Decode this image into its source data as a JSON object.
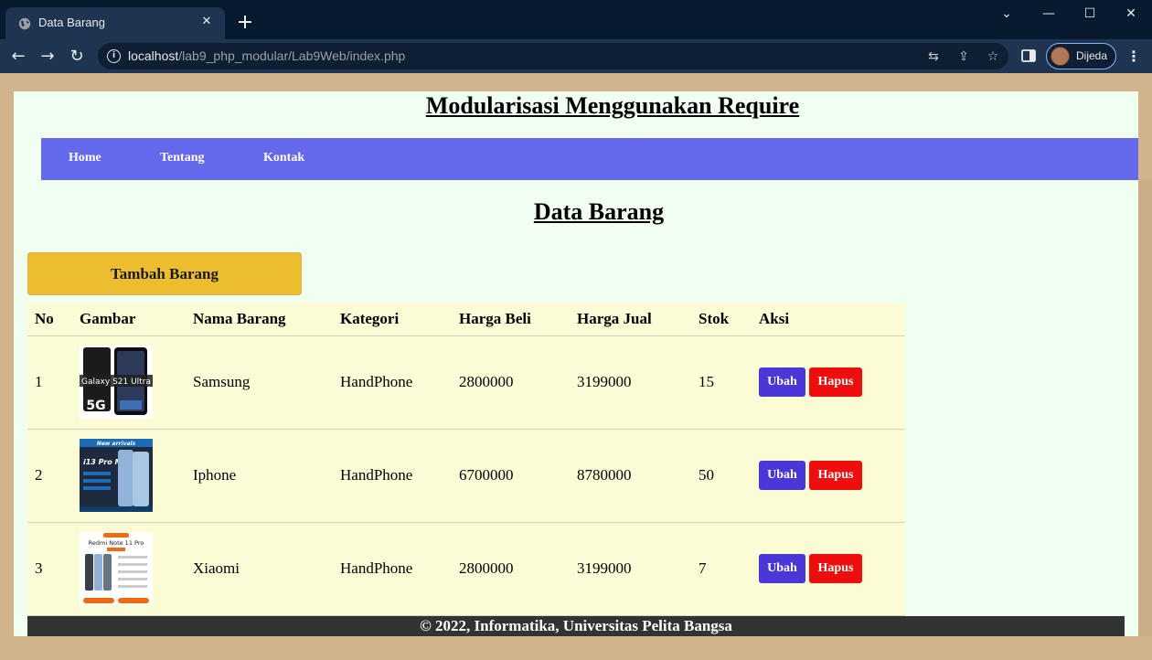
{
  "browser": {
    "tab_title": "Data Barang",
    "tab_close": "✕",
    "new_tab": "+",
    "url_host": "localhost",
    "url_path": "/lab9_php_modular/Lab9Web/index.php",
    "profile_name": "Dijeda",
    "window_controls": {
      "tab_search": "⌄",
      "minimize": "—",
      "maximize": "☐",
      "close": "✕"
    },
    "nav": {
      "back": "←",
      "forward": "→",
      "reload": "↻"
    },
    "omnibox_icons": {
      "translate": "⇆",
      "share": "⇪",
      "bookmark": "☆"
    },
    "menu": "⋮"
  },
  "page": {
    "title": "Modularisasi Menggunakan Require",
    "nav": [
      {
        "label": "Home"
      },
      {
        "label": "Tentang"
      },
      {
        "label": "Kontak"
      }
    ],
    "section_title": "Data Barang",
    "add_button": "Tambah Barang",
    "table": {
      "headers": [
        "No",
        "Gambar",
        "Nama Barang",
        "Kategori",
        "Harga Beli",
        "Harga Jual",
        "Stok",
        "Aksi"
      ],
      "rows": [
        {
          "no": "1",
          "nama": "Samsung",
          "kategori": "HandPhone",
          "harga_beli": "2800000",
          "harga_jual": "3199000",
          "stok": "15",
          "image_caption": "Galaxy S21 Ultra",
          "image_badge": "5G"
        },
        {
          "no": "2",
          "nama": "Iphone",
          "kategori": "HandPhone",
          "harga_beli": "6700000",
          "harga_jual": "8780000",
          "stok": "50",
          "image_caption": "New arrivals",
          "image_badge": "i13 Pro Max"
        },
        {
          "no": "3",
          "nama": "Xiaomi",
          "kategori": "HandPhone",
          "harga_beli": "2800000",
          "harga_jual": "3199000",
          "stok": "7",
          "image_caption": "Redmi Note 11 Pro",
          "image_badge": ""
        }
      ],
      "edit_label": "Ubah",
      "delete_label": "Hapus"
    },
    "footer": "© 2022, Informatika, Universitas Pelita Bangsa"
  },
  "colors": {
    "nav_bg": "#6469eb",
    "add_button": "#edbd30",
    "edit_button": "#4b37d8",
    "delete_button": "#ee0e0e",
    "table_bg": "#fbfbd6",
    "page_bg": "#f0fff0",
    "footer_bg": "#333333"
  }
}
